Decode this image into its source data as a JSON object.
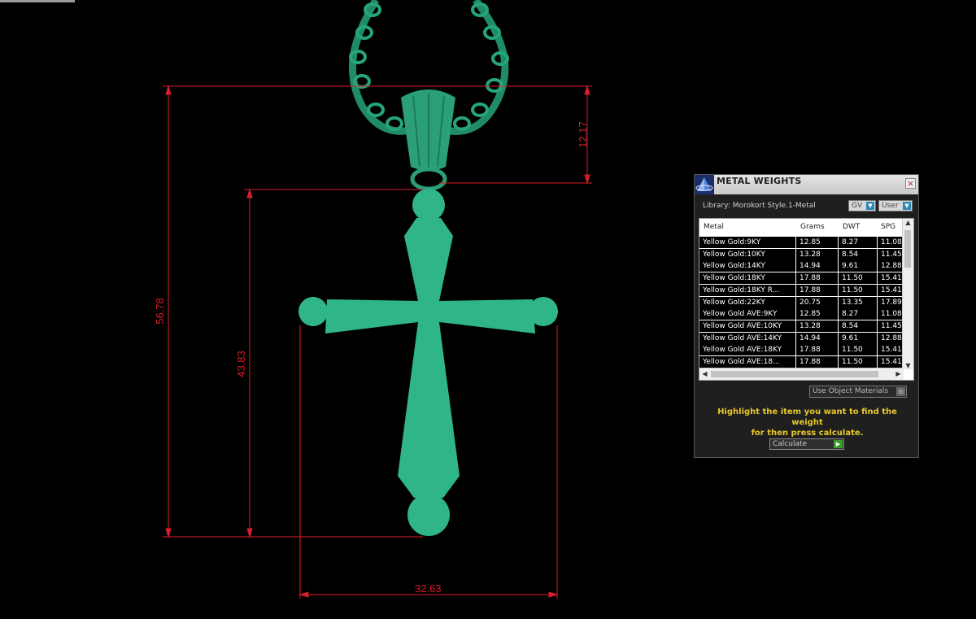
{
  "dimensions": {
    "total_height": "56.78",
    "cross_height": "43.83",
    "bail_height": "12.17",
    "width": "32.63"
  },
  "colors": {
    "model": "#2fb589",
    "dimension_line": "#d81e2a",
    "hint_text": "#e8c82a"
  },
  "panel": {
    "title": "METAL WEIGHTS",
    "close_glyph": "×",
    "library_label": "Library: Morokort Style.1-Metal",
    "gv_select": "GV",
    "user_select": "User",
    "columns": [
      "Metal",
      "Grams",
      "DWT",
      "SPG"
    ],
    "rows": [
      [
        "Yellow Gold:9KY",
        "12.85",
        "8.27",
        "11.08"
      ],
      [
        "Yellow Gold:10KY",
        "13.28",
        "8.54",
        "11.45"
      ],
      [
        "Yellow Gold:14KY",
        "14.94",
        "9.61",
        "12.88"
      ],
      [
        "Yellow Gold:18KY",
        "17.88",
        "11.50",
        "15.41"
      ],
      [
        "Yellow Gold:18KY R...",
        "17.88",
        "11.50",
        "15.41"
      ],
      [
        "Yellow Gold:22KY",
        "20.75",
        "13.35",
        "17.89"
      ],
      [
        "Yellow Gold AVE:9KY",
        "12.85",
        "8.27",
        "11.08"
      ],
      [
        "Yellow Gold AVE:10KY",
        "13.28",
        "8.54",
        "11.45"
      ],
      [
        "Yellow Gold AVE:14KY",
        "14.94",
        "9.61",
        "12.88"
      ],
      [
        "Yellow Gold AVE:18KY",
        "17.88",
        "11.50",
        "15.41"
      ],
      [
        "Yellow Gold AVE:18...",
        "17.88",
        "11.50",
        "15.41"
      ]
    ],
    "use_object_materials": "Use Object Materials",
    "hint_line1": "Highlight the item you want to find the weight",
    "hint_line2": "for then press calculate.",
    "calculate_label": "Calculate"
  },
  "icons": {
    "app_logo": "pyramid-logo-icon",
    "close": "close-icon",
    "dropdown": "chevron-down-icon",
    "go": "play-arrow-icon"
  }
}
